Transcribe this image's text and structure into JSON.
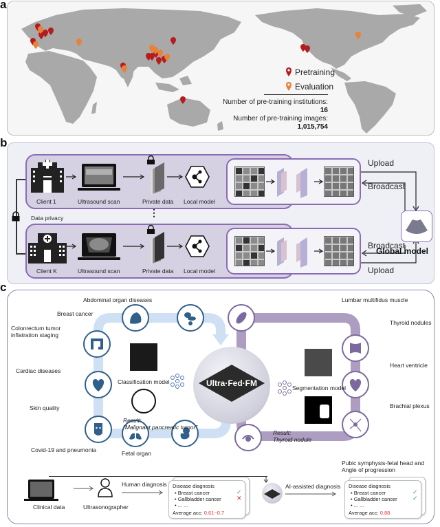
{
  "panels": {
    "a": {
      "letter": "a",
      "legend": [
        {
          "label": "Pretraining",
          "color": "#b71c1c"
        },
        {
          "label": "Evaluation",
          "color": "#e8823a"
        }
      ],
      "stats": {
        "institutions_label": "Number of pre-training institutions:",
        "institutions_value": "16",
        "images_label": "Number of pre-training images:",
        "images_value": "1,015,754"
      },
      "sites": {
        "pretraining_count_shown": 17,
        "evaluation_count_shown": 10
      }
    },
    "b": {
      "letter": "b",
      "clients": [
        {
          "name": "Client 1",
          "steps": [
            "Ultrasound scan",
            "Private data",
            "Local model"
          ]
        },
        {
          "name": "Client K",
          "steps": [
            "Ultrasound scan",
            "Private data",
            "Local model"
          ]
        }
      ],
      "data_privacy": "Data privacy",
      "ellipsis": "⋮",
      "upload": "Upload",
      "broadcast": "Broadcast",
      "global_model": "Global model"
    },
    "c": {
      "letter": "c",
      "left_loop": {
        "diseases": [
          "Abdominal organ diseases",
          "Breast cancer",
          "Colonrectum tumor inflatration staging",
          "Cardiac diseases",
          "Skin quality",
          "Covid-19 and pneumonia",
          "Fetal organ"
        ],
        "model": "Classification model",
        "result_label": "Result:",
        "result_value": "“Malignant pancreatic tumor”",
        "color": "#2f5f8a",
        "track_color": "#cfe0f5"
      },
      "right_loop": {
        "diseases": [
          "Lumbar multifidus muscle",
          "Thyroid nodules",
          "Heart ventricle",
          "Brachial plexus",
          "Pubic symphysis-fetal head and",
          "Angle of progression"
        ],
        "model": "Segmentation model",
        "result_label": "Result:",
        "result_value": "Thyroid nodule",
        "color": "#7b6a9e",
        "track_color": "#ad9dc0"
      },
      "center_title": "Ultra·Fed·FM",
      "bottom": {
        "clinical_data": "Clinical data",
        "ultrasonographer": "Ultrasonographer",
        "human_diagnosis": "Human diagnosis",
        "ai_diagnosis": "AI-assisted diagnosis",
        "human_card": {
          "title": "Disease diagnosis",
          "items": [
            "Breast cancer",
            "Gallbladder cancer",
            "... ..."
          ],
          "marks": [
            "check",
            "cross",
            ""
          ],
          "acc_label": "Average acc: ",
          "acc_value": "0.61~0.7"
        },
        "ai_card": {
          "title": "Disease diagnosis",
          "items": [
            "Breast cancer",
            "Gallbladder cancer",
            "... ..."
          ],
          "marks": [
            "check",
            "check",
            ""
          ],
          "acc_label": "Average acc: ",
          "acc_value": "0.88"
        }
      }
    }
  }
}
